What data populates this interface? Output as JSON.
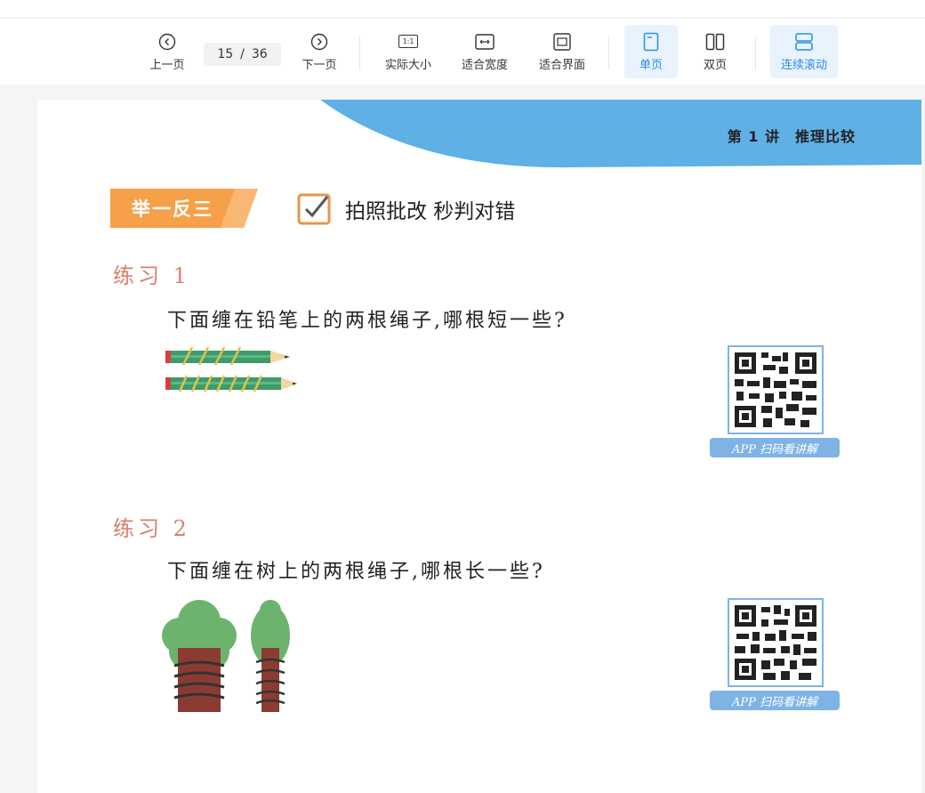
{
  "toolbar": {
    "prev_label": "上一页",
    "page_current": "15",
    "page_sep": "/",
    "page_total": "36",
    "next_label": "下一页",
    "actual_size_icon_text": "1:1",
    "actual_size_label": "实际大小",
    "fit_width_label": "适合宽度",
    "fit_page_label": "适合界面",
    "single_page_label": "单页",
    "double_page_label": "双页",
    "continuous_label": "连续滚动",
    "accent_color": "#2b8ce6"
  },
  "document": {
    "chapter": "第 1 讲　推理比较",
    "badge": "举一反三",
    "photo_check": "拍照批改 秒判对错",
    "exercises": [
      {
        "title": "练习 1",
        "question": "下面缠在铅笔上的两根绳子,哪根短一些?",
        "qr_caption": "APP 扫码看讲解"
      },
      {
        "title": "练习 2",
        "question": "下面缠在树上的两根绳子,哪根长一些?",
        "qr_caption": "APP 扫码看讲解"
      }
    ]
  }
}
